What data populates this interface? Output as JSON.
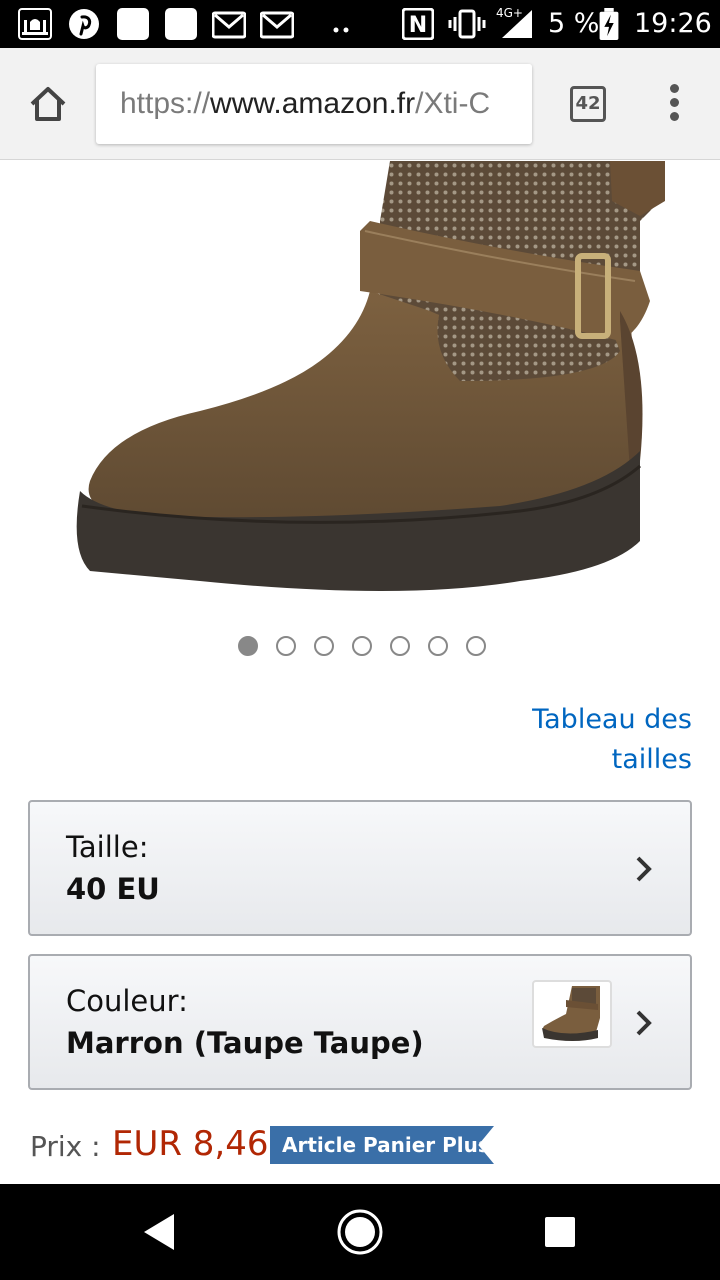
{
  "status_bar": {
    "nfc_label": "N",
    "network_label": "4G+",
    "battery_percent": "5 %",
    "time": "19:26"
  },
  "browser": {
    "url_scheme": "https://",
    "url_host": "www.amazon.fr",
    "url_path": "/Xti-C",
    "tab_count": "42"
  },
  "product": {
    "image_icon": "brown-ankle-boot",
    "carousel": {
      "count": 7,
      "active_index": 0
    },
    "size_chart_link": "Tableau des tailles",
    "size_selector": {
      "label": "Taille:",
      "value": "40 EU"
    },
    "color_selector": {
      "label": "Couleur:",
      "value": "Marron (Taupe Taupe)"
    },
    "price": {
      "label": "Prix :",
      "value": "EUR 8,46",
      "badge": "Article Panier Plus"
    }
  },
  "colors": {
    "link": "#0066c0",
    "price": "#b12704",
    "badge": "#3a6fa8"
  }
}
